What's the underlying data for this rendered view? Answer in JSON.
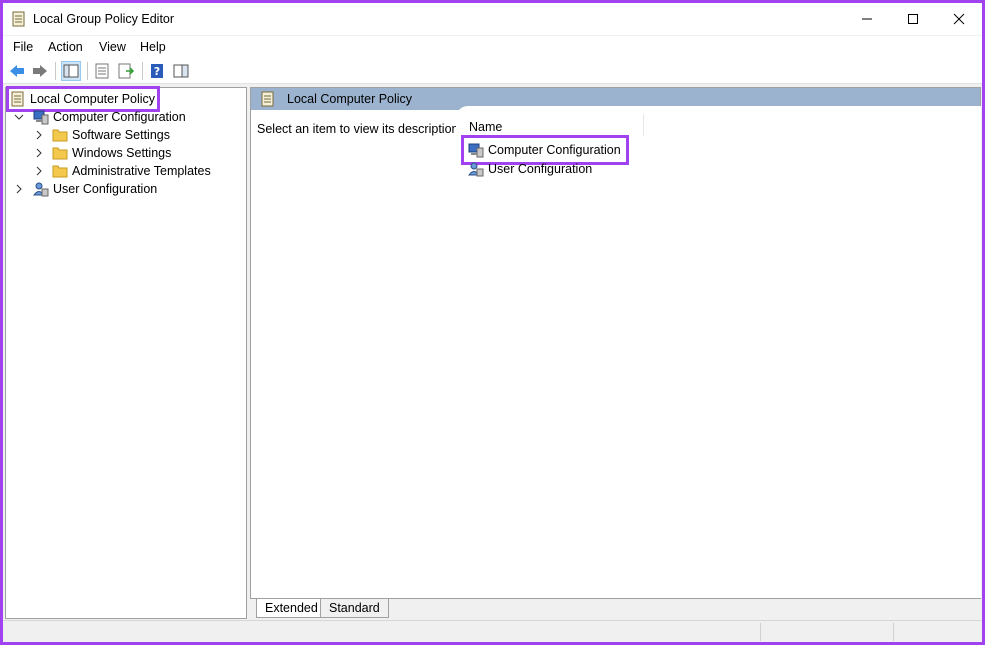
{
  "window": {
    "title": "Local Group Policy Editor"
  },
  "menu": [
    "File",
    "Action",
    "View",
    "Help"
  ],
  "tree": {
    "root": "Local Computer Policy",
    "items": [
      {
        "label": "Computer Configuration",
        "expanded": true
      },
      {
        "label": "Software Settings"
      },
      {
        "label": "Windows Settings"
      },
      {
        "label": "Administrative Templates"
      },
      {
        "label": "User Configuration",
        "expanded": false
      }
    ]
  },
  "right_pane": {
    "header": "Local Computer Policy",
    "description": "Select an item to view its description.",
    "column_header": "Name",
    "items": [
      "Computer Configuration",
      "User Configuration"
    ]
  },
  "tabs": [
    "Extended",
    "Standard"
  ],
  "colors": {
    "highlight": "#a042f0",
    "header_bg": "#9bb3cf"
  }
}
